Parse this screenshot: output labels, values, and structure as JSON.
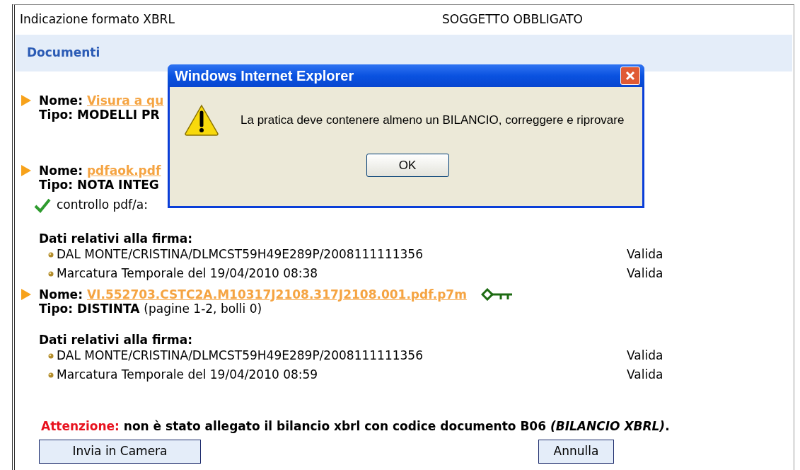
{
  "header": {
    "left": "Indicazione formato XBRL",
    "right": "SOGGETTO OBBLIGATO"
  },
  "section_title": "Documenti",
  "documents": [
    {
      "name_label": "Nome:",
      "name": "Visura a qu",
      "tipo_label": "Tipo:",
      "tipo": "MODELLI PR",
      "signed": false
    },
    {
      "name_label": "Nome:",
      "name": "pdfaok.pdf",
      "tipo_label": "Tipo:",
      "tipo": "NOTA INTEG",
      "signed": false,
      "check": "controllo pdf/a:",
      "firma": {
        "title": "Dati relativi alla firma:",
        "entries": [
          {
            "text": "DAL MONTE/CRISTINA/DLMCST59H49E289P/2008111111356",
            "status": "Valida"
          },
          {
            "text": "Marcatura Temporale del 19/04/2010 08:38",
            "status": "Valida"
          }
        ]
      }
    },
    {
      "name_label": "Nome:",
      "name": "VI.552703.CSTC2A.M10317J2108.317J2108.001.pdf.p7m",
      "tipo_label": "Tipo:",
      "tipo": "DISTINTA",
      "tipo_detail": "(pagine 1-2, bolli 0)",
      "signed": true,
      "firma": {
        "title": "Dati relativi alla firma:",
        "entries": [
          {
            "text": "DAL MONTE/CRISTINA/DLMCST59H49E289P/2008111111356",
            "status": "Valida"
          },
          {
            "text": "Marcatura Temporale del 19/04/2010 08:59",
            "status": "Valida"
          }
        ]
      }
    }
  ],
  "warning": {
    "label": "Attenzione:",
    "text": "non è stato allegato il bilancio xbrl con codice documento B06 ",
    "italic": "(BILANCIO XBRL)",
    "end": "."
  },
  "buttons": {
    "submit": "Invia in Camera",
    "cancel": "Annulla"
  },
  "dialog": {
    "title": "Windows Internet Explorer",
    "message": "La pratica deve contenere almeno un BILANCIO, correggere e riprovare",
    "ok": "OK"
  }
}
